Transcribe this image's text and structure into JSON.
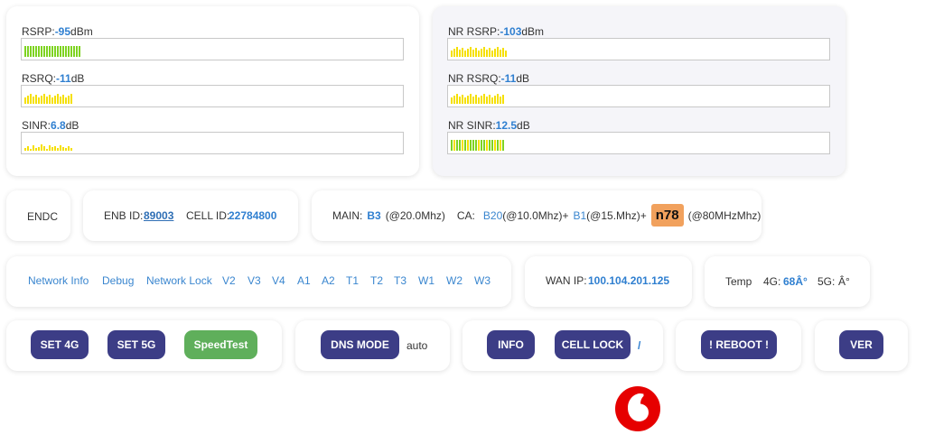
{
  "signal4g": {
    "rsrp": {
      "prefix": "RSRP:",
      "value": "-95",
      "unit": "dBm",
      "level": 0.15
    },
    "rsrq": {
      "prefix": "RSRQ:",
      "value": "-11",
      "unit": "dB",
      "level": 0.13
    },
    "sinr": {
      "prefix": "SINR:",
      "value": "6.8",
      "unit": "dB",
      "level": 0.13
    }
  },
  "signal5g": {
    "rsrp": {
      "prefix": "NR RSRP:",
      "value": "-103",
      "unit": "dBm",
      "level": 0.15
    },
    "rsrq": {
      "prefix": "NR RSRQ:",
      "value": "-11",
      "unit": "dB",
      "level": 0.14
    },
    "sinr": {
      "prefix": "NR SINR:",
      "value": "12.5",
      "unit": "dB",
      "level": 0.14
    }
  },
  "mode": {
    "label": "ENDC"
  },
  "ids": {
    "enb_label": "ENB ID:",
    "enb_value": "89003",
    "cell_label": "CELL ID:",
    "cell_value": "22784800"
  },
  "bands": {
    "main_label": "MAIN:",
    "main_band": "B3",
    "main_bw": "(@20.0Mhz)",
    "ca_label": "CA:",
    "ca1_band": "B20",
    "ca1_bw": "(@10.0Mhz)+",
    "ca2_band": "B1",
    "ca2_bw": "(@15.Mhz)+",
    "nr_band": "n78",
    "nr_bw": "(@80MHzMhz)"
  },
  "nav": [
    "Network Info",
    "Debug",
    "Network Lock",
    "V2",
    "V3",
    "V4",
    "A1",
    "A2",
    "T1",
    "T2",
    "T3",
    "W1",
    "W2",
    "W3"
  ],
  "wan": {
    "label": "WAN IP:",
    "value": "100.104.201.125"
  },
  "temp": {
    "label": "Temp",
    "t4g_label": "4G:",
    "t4g_value": "68Â°",
    "t5g_label": "5G:",
    "t5g_value": "Â°"
  },
  "buttons": {
    "set4g": "SET 4G",
    "set5g": "SET 5G",
    "speedtest": "SpeedTest",
    "dns": "DNS MODE",
    "dns_value": "auto",
    "info": "INFO",
    "celllock": "CELL LOCK",
    "celllock_value": "/",
    "reboot": "! REBOOT !",
    "ver": "VER"
  },
  "colors": {
    "green": "#7ed321",
    "yellow": "#f5e000",
    "button": "#3c3d86",
    "speedtest": "#5faf5b",
    "accent": "#2f7fd0",
    "logo": "#e60000"
  }
}
